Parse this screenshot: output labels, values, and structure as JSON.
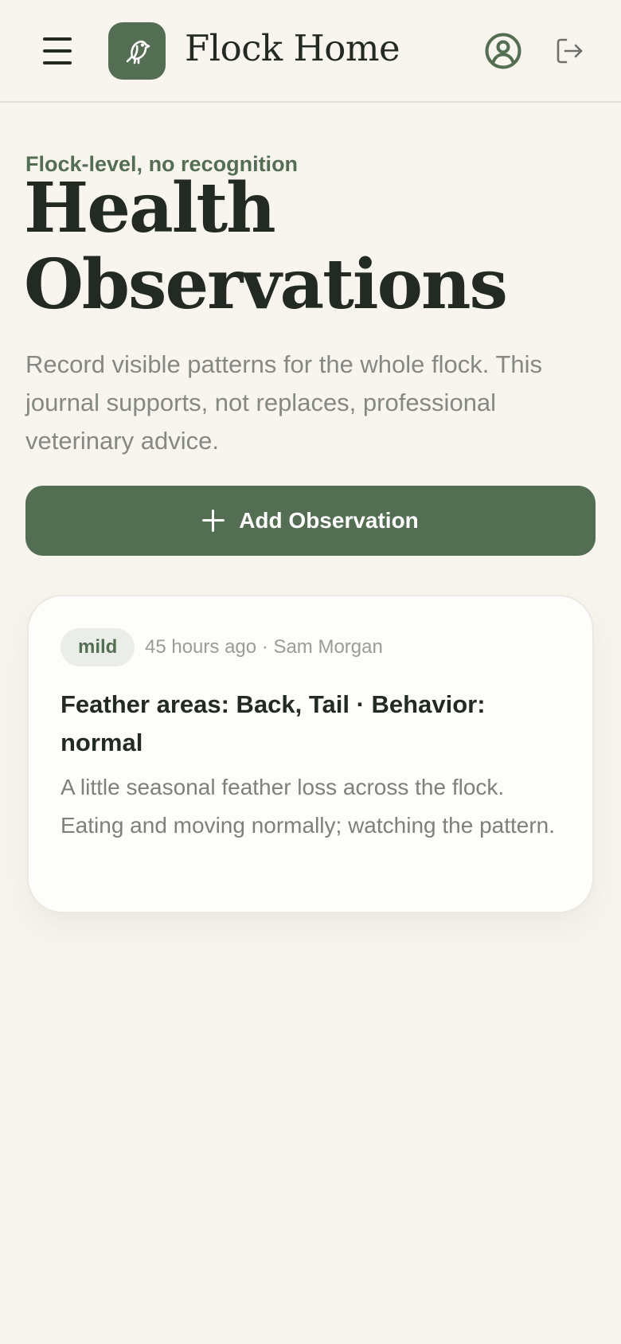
{
  "header": {
    "app_title": "Flock Home",
    "menu_icon": "hamburger-menu-icon",
    "logo_icon": "bird-icon",
    "profile_icon": "user-circle-icon",
    "logout_icon": "logout-icon"
  },
  "page": {
    "eyebrow": "Flock-level, no recognition",
    "title": "Health Observations",
    "intro": "Record visible patterns for the whole flock. This journal supports, not replaces, professional veterinary advice."
  },
  "actions": {
    "add_label": "Add Observation",
    "add_icon": "plus-icon"
  },
  "observations": [
    {
      "severity": "mild",
      "meta": "45 hours ago · Sam Morgan",
      "title": "Feather areas: Back, Tail · Behavior: normal",
      "note": "A little seasonal feather loss across the flock. Eating and moving normally; watching the pattern."
    }
  ],
  "colors": {
    "background": "#f8f5ef",
    "accent": "#546e54",
    "text": "#232a24",
    "muted": "#868884",
    "badge_bg": "#ebeee8",
    "card_bg": "#fdfdfb"
  }
}
